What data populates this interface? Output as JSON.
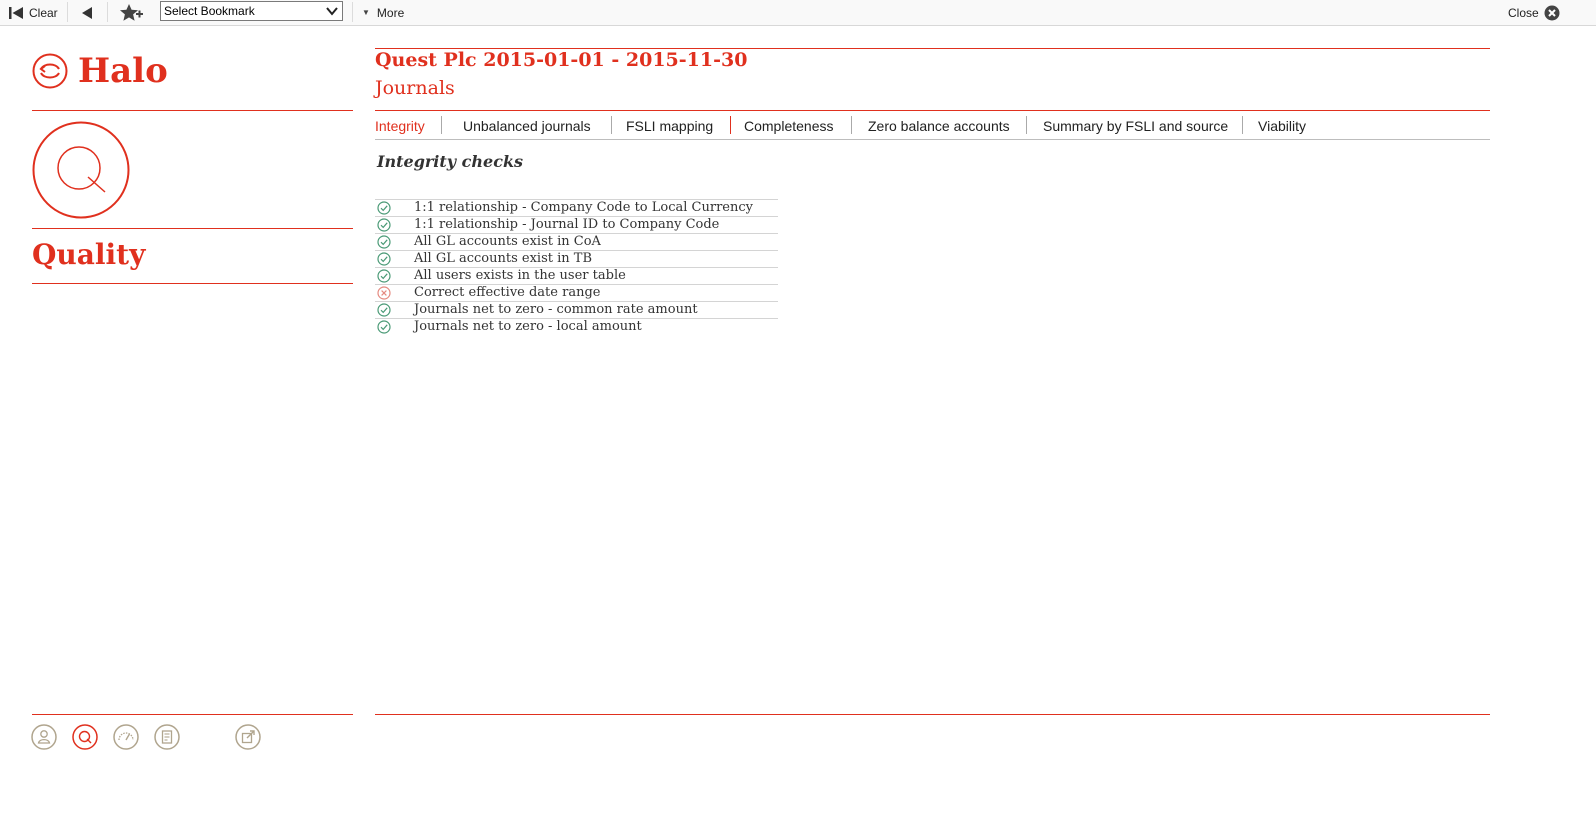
{
  "toolbar": {
    "clear_label": "Clear",
    "bookmark_selected": "Select Bookmark",
    "more_label": "More",
    "close_label": "Close"
  },
  "sidebar": {
    "app_name": "Halo",
    "section_title": "Quality"
  },
  "header": {
    "title": "Quest Plc 2015-01-01 - 2015-11-30",
    "subtitle": "Journals"
  },
  "tabs": [
    {
      "label": "Integrity",
      "active": true
    },
    {
      "label": "Unbalanced journals",
      "active": false
    },
    {
      "label": "FSLI mapping",
      "active": false
    },
    {
      "label": "Completeness",
      "active": false
    },
    {
      "label": "Zero balance accounts",
      "active": false
    },
    {
      "label": "Summary by FSLI and source",
      "active": false
    },
    {
      "label": "Viability",
      "active": false
    }
  ],
  "main": {
    "section_heading": "Integrity checks",
    "checks": [
      {
        "label": "1:1 relationship - Company Code to Local Currency",
        "status": "pass"
      },
      {
        "label": "1:1 relationship - Journal ID to Company Code",
        "status": "pass"
      },
      {
        "label": "All GL accounts exist in CoA",
        "status": "pass"
      },
      {
        "label": "All GL accounts exist in TB",
        "status": "pass"
      },
      {
        "label": "All users exists in the user table",
        "status": "pass"
      },
      {
        "label": "Correct effective date range",
        "status": "fail"
      },
      {
        "label": "Journals net to zero - common rate amount",
        "status": "pass"
      },
      {
        "label": "Journals net to zero - local amount",
        "status": "pass"
      }
    ]
  },
  "footer": {
    "icons": [
      "user-icon",
      "quality-icon",
      "gauge-icon",
      "document-icon",
      "external-link-icon"
    ]
  },
  "colors": {
    "accent": "#e0301e",
    "pass": "#4a9a76",
    "fail": "#e58a80",
    "footer_icon": "#b0a58e"
  }
}
